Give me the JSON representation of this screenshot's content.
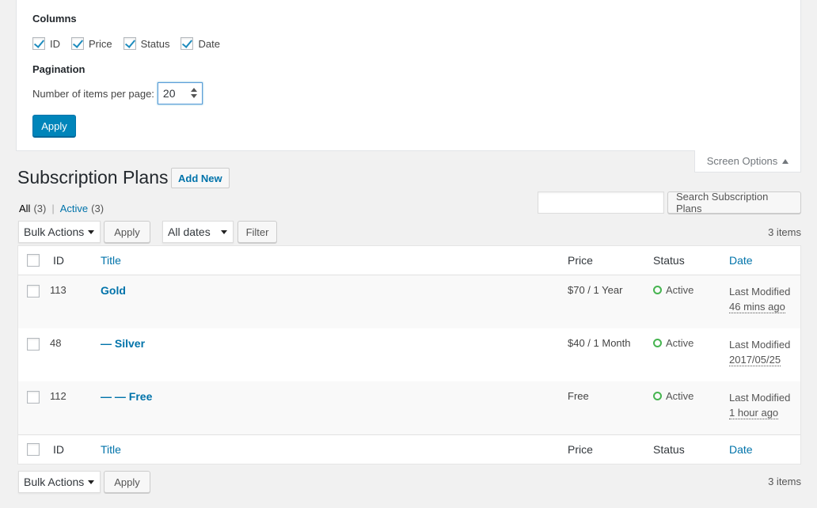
{
  "screen_options": {
    "columns_title": "Columns",
    "columns": [
      {
        "label": "ID",
        "checked": true
      },
      {
        "label": "Price",
        "checked": true
      },
      {
        "label": "Status",
        "checked": true
      },
      {
        "label": "Date",
        "checked": true
      }
    ],
    "pagination_title": "Pagination",
    "per_page_label": "Number of items per page:",
    "per_page_value": "20",
    "apply_label": "Apply",
    "tab_label": "Screen Options"
  },
  "header": {
    "title": "Subscription Plans",
    "add_new": "Add New"
  },
  "filters": {
    "all_label": "All",
    "all_count": "(3)",
    "separator": "|",
    "active_label": "Active",
    "active_count": "(3)"
  },
  "search": {
    "placeholder": "",
    "button": "Search Subscription Plans"
  },
  "top_nav": {
    "bulk_actions": "Bulk Actions",
    "apply": "Apply",
    "dates": "All dates",
    "filter": "Filter",
    "items_count": "3 items"
  },
  "table": {
    "columns": {
      "id": "ID",
      "title": "Title",
      "price": "Price",
      "status": "Status",
      "date": "Date"
    },
    "rows": [
      {
        "id": "113",
        "title": "Gold",
        "price": "$70 / 1 Year",
        "status": "Active",
        "date_label": "Last Modified",
        "date_value": "46 mins ago"
      },
      {
        "id": "48",
        "title": "— Silver",
        "price": "$40 / 1 Month",
        "status": "Active",
        "date_label": "Last Modified",
        "date_value": "2017/05/25"
      },
      {
        "id": "112",
        "title": "— — Free",
        "price": "Free",
        "status": "Active",
        "date_label": "Last Modified",
        "date_value": "1 hour ago"
      }
    ]
  },
  "bottom_nav": {
    "bulk_actions": "Bulk Actions",
    "apply": "Apply",
    "items_count": "3 items"
  },
  "colors": {
    "primary": "#0085ba",
    "link": "#0073aa",
    "active_status": "#46b450"
  }
}
